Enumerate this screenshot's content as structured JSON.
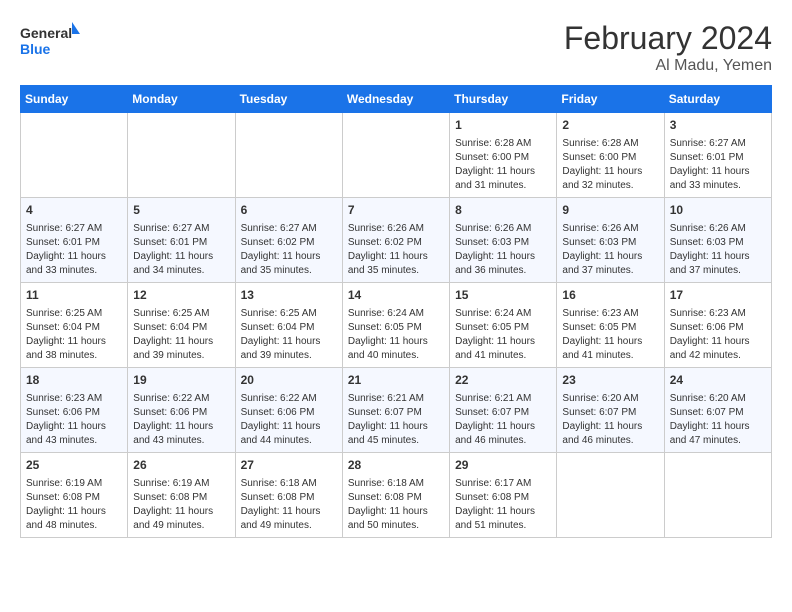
{
  "header": {
    "logo_general": "General",
    "logo_blue": "Blue",
    "month_year": "February 2024",
    "location": "Al Madu, Yemen"
  },
  "weekdays": [
    "Sunday",
    "Monday",
    "Tuesday",
    "Wednesday",
    "Thursday",
    "Friday",
    "Saturday"
  ],
  "weeks": [
    [
      {
        "day": "",
        "info": ""
      },
      {
        "day": "",
        "info": ""
      },
      {
        "day": "",
        "info": ""
      },
      {
        "day": "",
        "info": ""
      },
      {
        "day": "1",
        "info": "Sunrise: 6:28 AM\nSunset: 6:00 PM\nDaylight: 11 hours and 31 minutes."
      },
      {
        "day": "2",
        "info": "Sunrise: 6:28 AM\nSunset: 6:00 PM\nDaylight: 11 hours and 32 minutes."
      },
      {
        "day": "3",
        "info": "Sunrise: 6:27 AM\nSunset: 6:01 PM\nDaylight: 11 hours and 33 minutes."
      }
    ],
    [
      {
        "day": "4",
        "info": "Sunrise: 6:27 AM\nSunset: 6:01 PM\nDaylight: 11 hours and 33 minutes."
      },
      {
        "day": "5",
        "info": "Sunrise: 6:27 AM\nSunset: 6:01 PM\nDaylight: 11 hours and 34 minutes."
      },
      {
        "day": "6",
        "info": "Sunrise: 6:27 AM\nSunset: 6:02 PM\nDaylight: 11 hours and 35 minutes."
      },
      {
        "day": "7",
        "info": "Sunrise: 6:26 AM\nSunset: 6:02 PM\nDaylight: 11 hours and 35 minutes."
      },
      {
        "day": "8",
        "info": "Sunrise: 6:26 AM\nSunset: 6:03 PM\nDaylight: 11 hours and 36 minutes."
      },
      {
        "day": "9",
        "info": "Sunrise: 6:26 AM\nSunset: 6:03 PM\nDaylight: 11 hours and 37 minutes."
      },
      {
        "day": "10",
        "info": "Sunrise: 6:26 AM\nSunset: 6:03 PM\nDaylight: 11 hours and 37 minutes."
      }
    ],
    [
      {
        "day": "11",
        "info": "Sunrise: 6:25 AM\nSunset: 6:04 PM\nDaylight: 11 hours and 38 minutes."
      },
      {
        "day": "12",
        "info": "Sunrise: 6:25 AM\nSunset: 6:04 PM\nDaylight: 11 hours and 39 minutes."
      },
      {
        "day": "13",
        "info": "Sunrise: 6:25 AM\nSunset: 6:04 PM\nDaylight: 11 hours and 39 minutes."
      },
      {
        "day": "14",
        "info": "Sunrise: 6:24 AM\nSunset: 6:05 PM\nDaylight: 11 hours and 40 minutes."
      },
      {
        "day": "15",
        "info": "Sunrise: 6:24 AM\nSunset: 6:05 PM\nDaylight: 11 hours and 41 minutes."
      },
      {
        "day": "16",
        "info": "Sunrise: 6:23 AM\nSunset: 6:05 PM\nDaylight: 11 hours and 41 minutes."
      },
      {
        "day": "17",
        "info": "Sunrise: 6:23 AM\nSunset: 6:06 PM\nDaylight: 11 hours and 42 minutes."
      }
    ],
    [
      {
        "day": "18",
        "info": "Sunrise: 6:23 AM\nSunset: 6:06 PM\nDaylight: 11 hours and 43 minutes."
      },
      {
        "day": "19",
        "info": "Sunrise: 6:22 AM\nSunset: 6:06 PM\nDaylight: 11 hours and 43 minutes."
      },
      {
        "day": "20",
        "info": "Sunrise: 6:22 AM\nSunset: 6:06 PM\nDaylight: 11 hours and 44 minutes."
      },
      {
        "day": "21",
        "info": "Sunrise: 6:21 AM\nSunset: 6:07 PM\nDaylight: 11 hours and 45 minutes."
      },
      {
        "day": "22",
        "info": "Sunrise: 6:21 AM\nSunset: 6:07 PM\nDaylight: 11 hours and 46 minutes."
      },
      {
        "day": "23",
        "info": "Sunrise: 6:20 AM\nSunset: 6:07 PM\nDaylight: 11 hours and 46 minutes."
      },
      {
        "day": "24",
        "info": "Sunrise: 6:20 AM\nSunset: 6:07 PM\nDaylight: 11 hours and 47 minutes."
      }
    ],
    [
      {
        "day": "25",
        "info": "Sunrise: 6:19 AM\nSunset: 6:08 PM\nDaylight: 11 hours and 48 minutes."
      },
      {
        "day": "26",
        "info": "Sunrise: 6:19 AM\nSunset: 6:08 PM\nDaylight: 11 hours and 49 minutes."
      },
      {
        "day": "27",
        "info": "Sunrise: 6:18 AM\nSunset: 6:08 PM\nDaylight: 11 hours and 49 minutes."
      },
      {
        "day": "28",
        "info": "Sunrise: 6:18 AM\nSunset: 6:08 PM\nDaylight: 11 hours and 50 minutes."
      },
      {
        "day": "29",
        "info": "Sunrise: 6:17 AM\nSunset: 6:08 PM\nDaylight: 11 hours and 51 minutes."
      },
      {
        "day": "",
        "info": ""
      },
      {
        "day": "",
        "info": ""
      }
    ]
  ]
}
